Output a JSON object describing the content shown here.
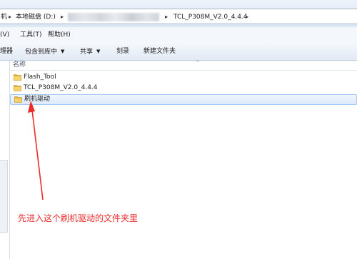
{
  "address_bar": {
    "crumbs": [
      {
        "label": "机"
      },
      {
        "label": "本地磁盘 (D:)"
      },
      {
        "label": "TCL_P308M_V2.0_4.4.4"
      }
    ]
  },
  "menu": {
    "items": [
      {
        "label": "(V)"
      },
      {
        "label": "工具(T)"
      },
      {
        "label": "帮助(H)"
      }
    ]
  },
  "commands": {
    "items": [
      {
        "label": "理器",
        "has_dropdown": false
      },
      {
        "label": "包含到库中",
        "has_dropdown": true
      },
      {
        "label": "共享",
        "has_dropdown": true
      },
      {
        "label": "刻录",
        "has_dropdown": false
      },
      {
        "label": "新建文件夹",
        "has_dropdown": false
      }
    ]
  },
  "file_list": {
    "column_name": "名称",
    "rows": [
      {
        "name": "Flash_Tool",
        "icon": "folder-icon",
        "selected": false
      },
      {
        "name": "TCL_P308M_V2.0_4.4.4",
        "icon": "folder-icon",
        "selected": false
      },
      {
        "name": "刷机驱动",
        "icon": "folder-icon",
        "selected": true
      }
    ]
  },
  "annotation": {
    "text": "先进入这个刷机驱动的文件夹里",
    "color": "#ee2b2b"
  },
  "colors": {
    "selection_border": "#a9c8ee",
    "folder_yellow": "#f2c94c",
    "toolbar_blue": "#dbe6f4"
  }
}
